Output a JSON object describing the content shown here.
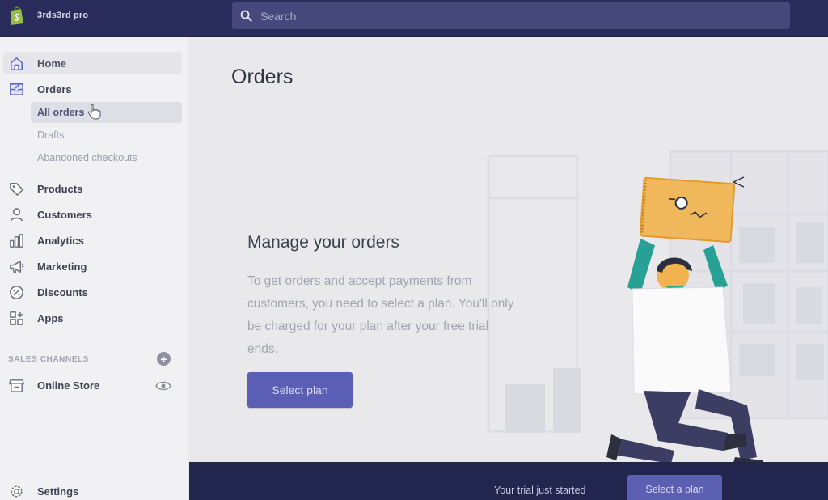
{
  "store": {
    "name": "3rds3rd pro"
  },
  "search": {
    "placeholder": "Search",
    "icon": "search-icon"
  },
  "sidebar": {
    "items": [
      {
        "label": "Home",
        "icon": "home-icon"
      },
      {
        "label": "Orders",
        "icon": "orders-icon"
      },
      {
        "label": "Products",
        "icon": "tag-icon"
      },
      {
        "label": "Customers",
        "icon": "person-icon"
      },
      {
        "label": "Analytics",
        "icon": "bar-chart-icon"
      },
      {
        "label": "Marketing",
        "icon": "megaphone-icon"
      },
      {
        "label": "Discounts",
        "icon": "discount-icon"
      },
      {
        "label": "Apps",
        "icon": "apps-icon"
      }
    ],
    "orders_sub": [
      "All orders",
      "Drafts",
      "Abandoned checkouts"
    ],
    "sales_channels_title": "SALES CHANNELS",
    "channels": [
      {
        "label": "Online Store",
        "icon": "store-icon"
      }
    ],
    "settings": {
      "label": "Settings",
      "icon": "gear-icon"
    }
  },
  "main": {
    "title": "Orders",
    "empty_state": {
      "heading": "Manage your orders",
      "body": "To get orders and accept payments from customers, you need to select a plan. You'll only be charged for your plan after your free trial ends.",
      "button": "Select plan"
    }
  },
  "trial_bar": {
    "text": "Your trial just started",
    "button": "Select a plan"
  },
  "colors": {
    "topbar": "#2a2c5b",
    "search": "#46487c",
    "accent": "#5a5fb5",
    "sidebar_bg": "#f1f1f3",
    "main_bg": "#e9e9ec",
    "trial_bar": "#22254e"
  }
}
